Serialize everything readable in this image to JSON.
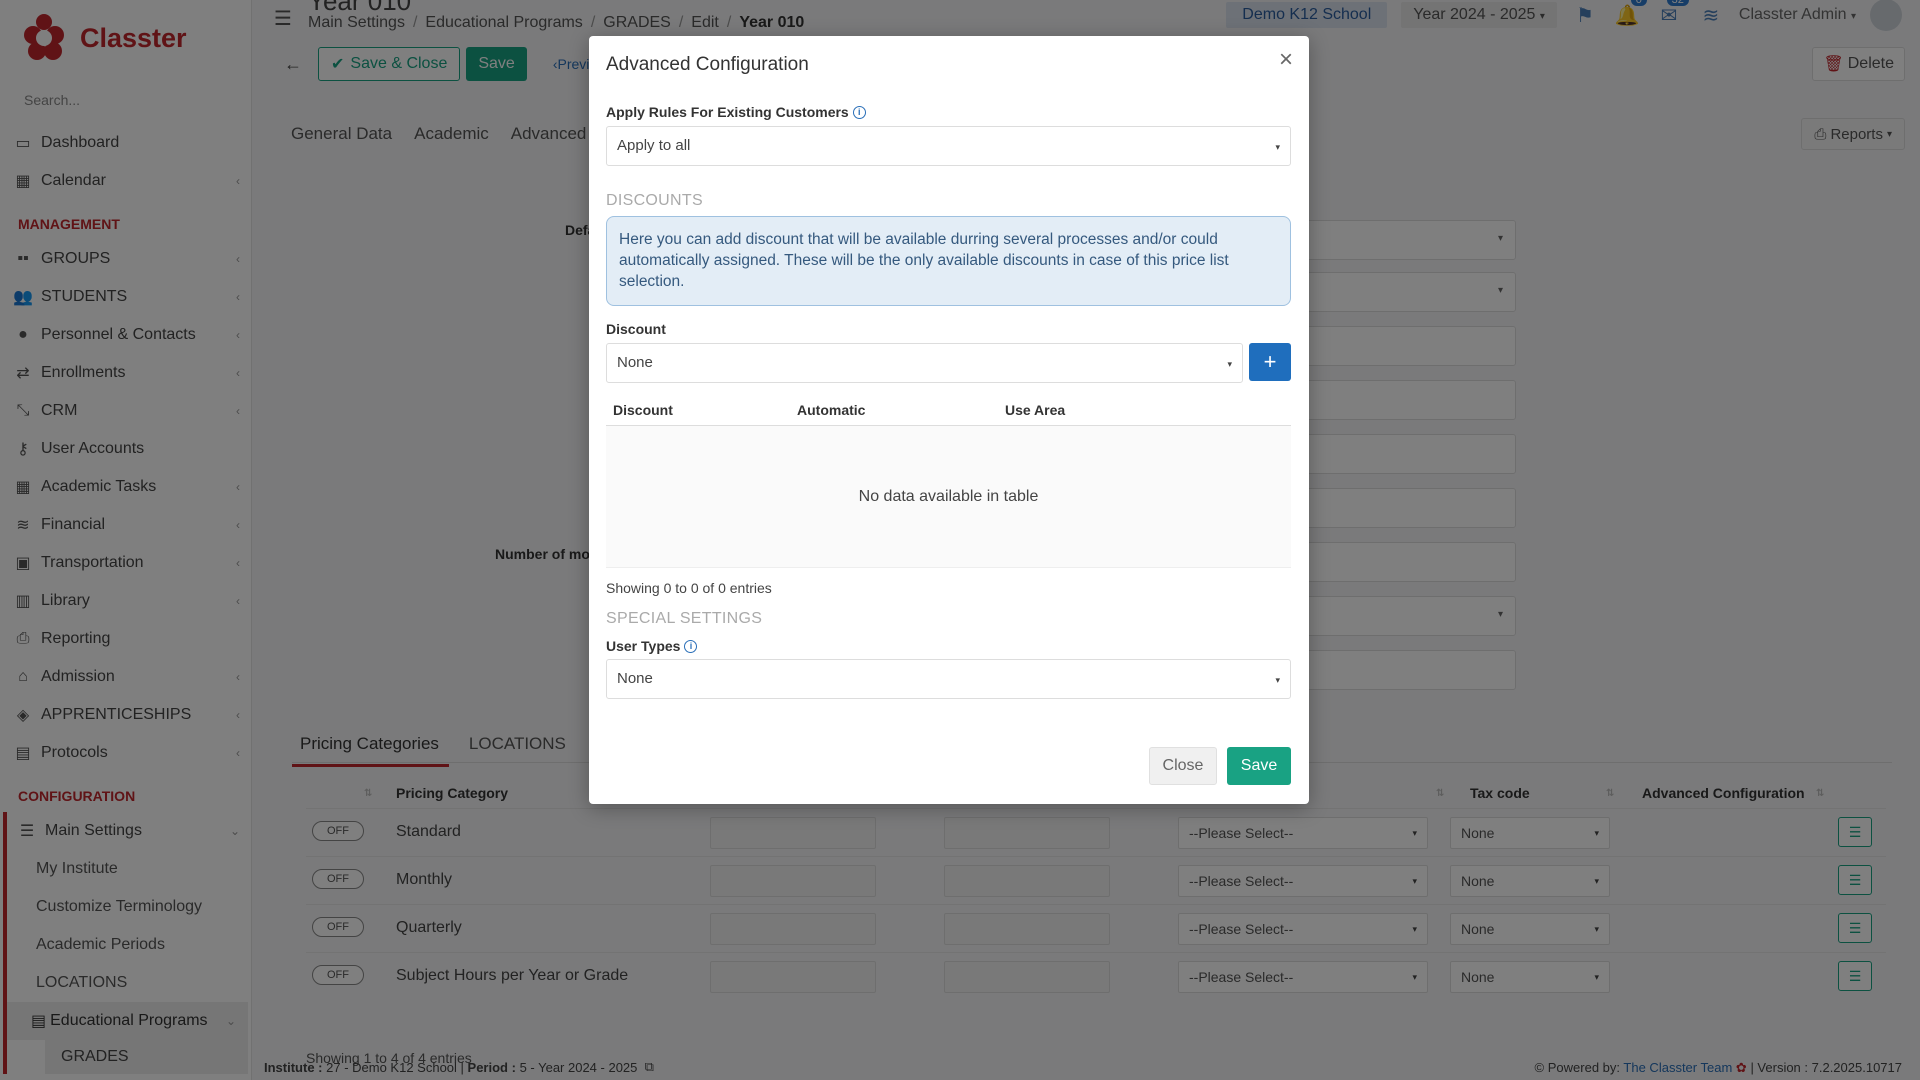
{
  "app": {
    "name": "Classter",
    "search_placeholder": "Search..."
  },
  "sidebar": {
    "items_top": [
      {
        "label": "Dashboard",
        "icon": "laptop-icon",
        "chevron": false
      },
      {
        "label": "Calendar",
        "icon": "calendar-icon",
        "chevron": true
      }
    ],
    "management_title": "MANAGEMENT",
    "management": [
      {
        "label": "GROUPS",
        "icon": "groups-icon"
      },
      {
        "label": "STUDENTS",
        "icon": "students-icon"
      },
      {
        "label": "Personnel & Contacts",
        "icon": "personnel-icon"
      },
      {
        "label": "Enrollments",
        "icon": "enrollments-icon"
      },
      {
        "label": "CRM",
        "icon": "crm-icon"
      },
      {
        "label": "User Accounts",
        "icon": "key-icon"
      },
      {
        "label": "Academic Tasks",
        "icon": "tasks-icon"
      },
      {
        "label": "Financial",
        "icon": "financial-icon"
      },
      {
        "label": "Transportation",
        "icon": "bus-icon"
      },
      {
        "label": "Library",
        "icon": "library-icon"
      },
      {
        "label": "Reporting",
        "icon": "print-icon"
      },
      {
        "label": "Admission",
        "icon": "admission-icon"
      },
      {
        "label": "APPRENTICESHIPS",
        "icon": "box-icon"
      },
      {
        "label": "Protocols",
        "icon": "protocols-icon"
      }
    ],
    "configuration_title": "CONFIGURATION",
    "main_settings": "Main Settings",
    "sub_items": [
      "My Institute",
      "Customize Terminology",
      "Academic Periods",
      "LOCATIONS"
    ],
    "educational_programs": "Educational Programs",
    "grades": "GRADES"
  },
  "header": {
    "title": "Year 010",
    "breadcrumb": [
      "Main Settings",
      "Educational Programs",
      "GRADES",
      "Edit",
      "Year 010"
    ],
    "school": "Demo K12 School",
    "year": "Year 2024 - 2025",
    "notif_count": "0",
    "mail_count": "32",
    "user": "Classter Admin"
  },
  "toolbar": {
    "save_close": "Save & Close",
    "save": "Save",
    "prev": "Previ",
    "delete": "Delete",
    "reports": "Reports"
  },
  "tabs": [
    "General Data",
    "Academic",
    "Advanced"
  ],
  "bg_form": {
    "label_default": "Defa",
    "label_months": "Number of mor"
  },
  "pricing": {
    "tabs": [
      "Pricing Categories",
      "LOCATIONS"
    ],
    "headers": {
      "category": "Pricing Category",
      "tax": "Tax code",
      "advanced": "Advanced Configuration"
    },
    "toggle_label": "OFF",
    "please_select": "--Please Select--",
    "none": "None",
    "rows": [
      "Standard",
      "Monthly",
      "Quarterly",
      "Subject Hours per Year or Grade"
    ],
    "showing": "Showing 1 to 4 of 4 entries"
  },
  "footer": {
    "institute_label": "Institute :",
    "institute": "27 - Demo K12 School",
    "period_label": "Period :",
    "period": "5 - Year 2024 - 2025",
    "powered_label": "Powered by:",
    "powered_link": "The Classter Team",
    "version": "| Version : 7.2.2025.10717"
  },
  "modal": {
    "title": "Advanced Configuration",
    "apply_rules_label": "Apply Rules For Existing Customers",
    "apply_rules_value": "Apply to all",
    "discounts_section": "DISCOUNTS",
    "discounts_info": "Here you can add discount that will be available durring several processes and/or could automatically assigned. These will be the only available discounts in case of this price list selection.",
    "discount_label": "Discount",
    "discount_value": "None",
    "table_headers": [
      "Discount",
      "Automatic",
      "Use Area"
    ],
    "empty_text": "No data available in table",
    "showing": "Showing 0 to 0 of 0 entries",
    "special_section": "SPECIAL SETTINGS",
    "user_types_label": "User Types",
    "user_types_value": "None",
    "close_btn": "Close",
    "save_btn": "Save"
  },
  "colors": {
    "brand": "#c0272d",
    "accent_green": "#19a283",
    "accent_blue": "#1f6ebd"
  }
}
